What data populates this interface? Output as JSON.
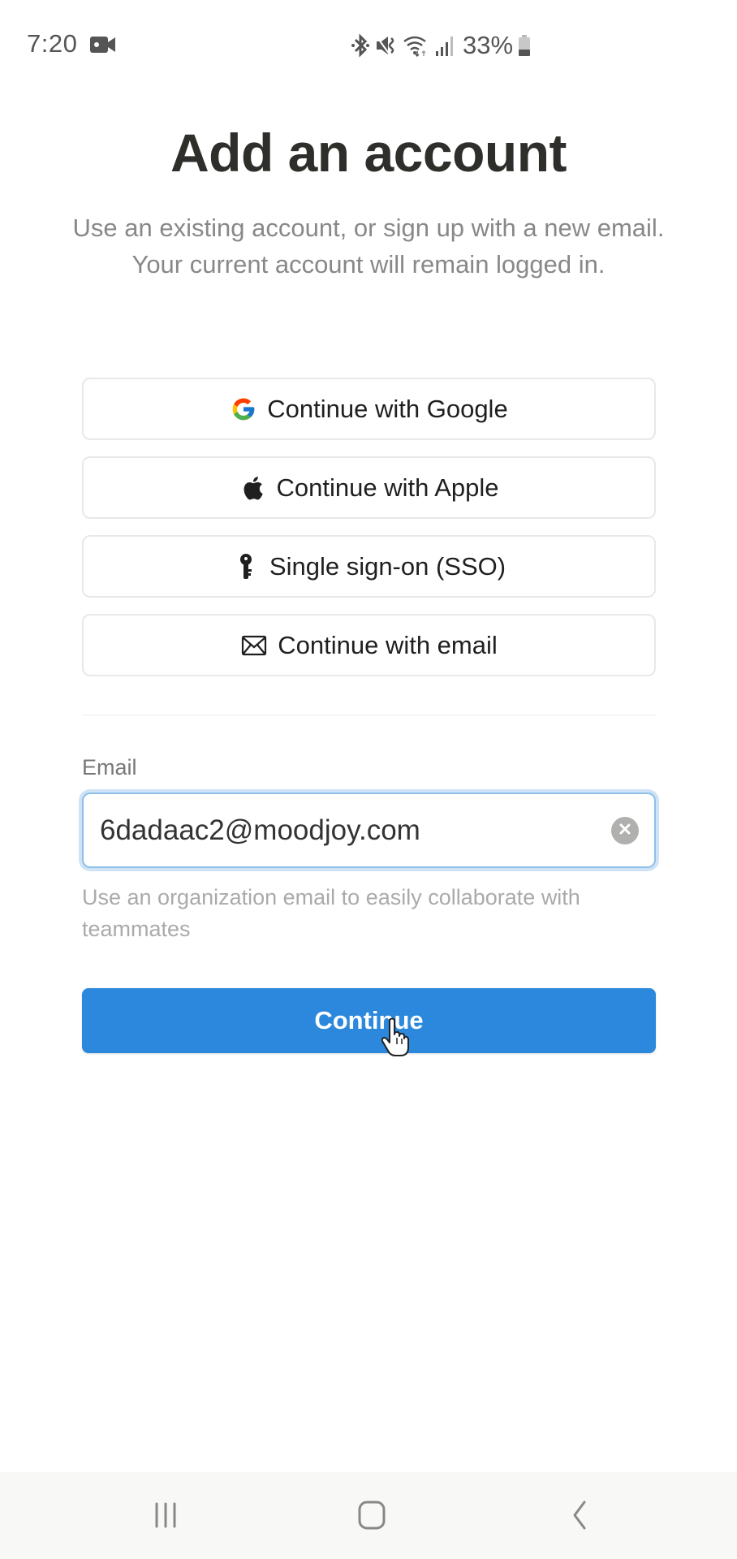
{
  "status_bar": {
    "time": "7:20",
    "left_icons": [
      "video-recording-icon"
    ],
    "right_icons": [
      "bluetooth-icon",
      "vibrate-mute-icon",
      "wifi-icon",
      "signal-icon",
      "battery-icon"
    ],
    "battery_percent": "33%"
  },
  "header": {
    "title": "Add an account",
    "subtitle": "Use an existing account, or sign up with a new email. Your current account will remain logged in."
  },
  "auth_options": [
    {
      "label": "Continue with Google",
      "icon": "google-icon"
    },
    {
      "label": "Continue with Apple",
      "icon": "apple-icon"
    },
    {
      "label": "Single sign-on (SSO)",
      "icon": "key-icon"
    },
    {
      "label": "Continue with email",
      "icon": "envelope-icon"
    }
  ],
  "email_form": {
    "label": "Email",
    "value": "6dadaac2@moodjoy.com",
    "helper": "Use an organization email to easily collaborate with teammates",
    "submit_label": "Continue"
  },
  "colors": {
    "primary": "#2b88dc",
    "focus_ring": "#8fbfe8",
    "title": "#2e2e2a",
    "muted": "#888888"
  },
  "nav_bar": {
    "buttons": [
      "recent-apps",
      "home",
      "back"
    ]
  }
}
